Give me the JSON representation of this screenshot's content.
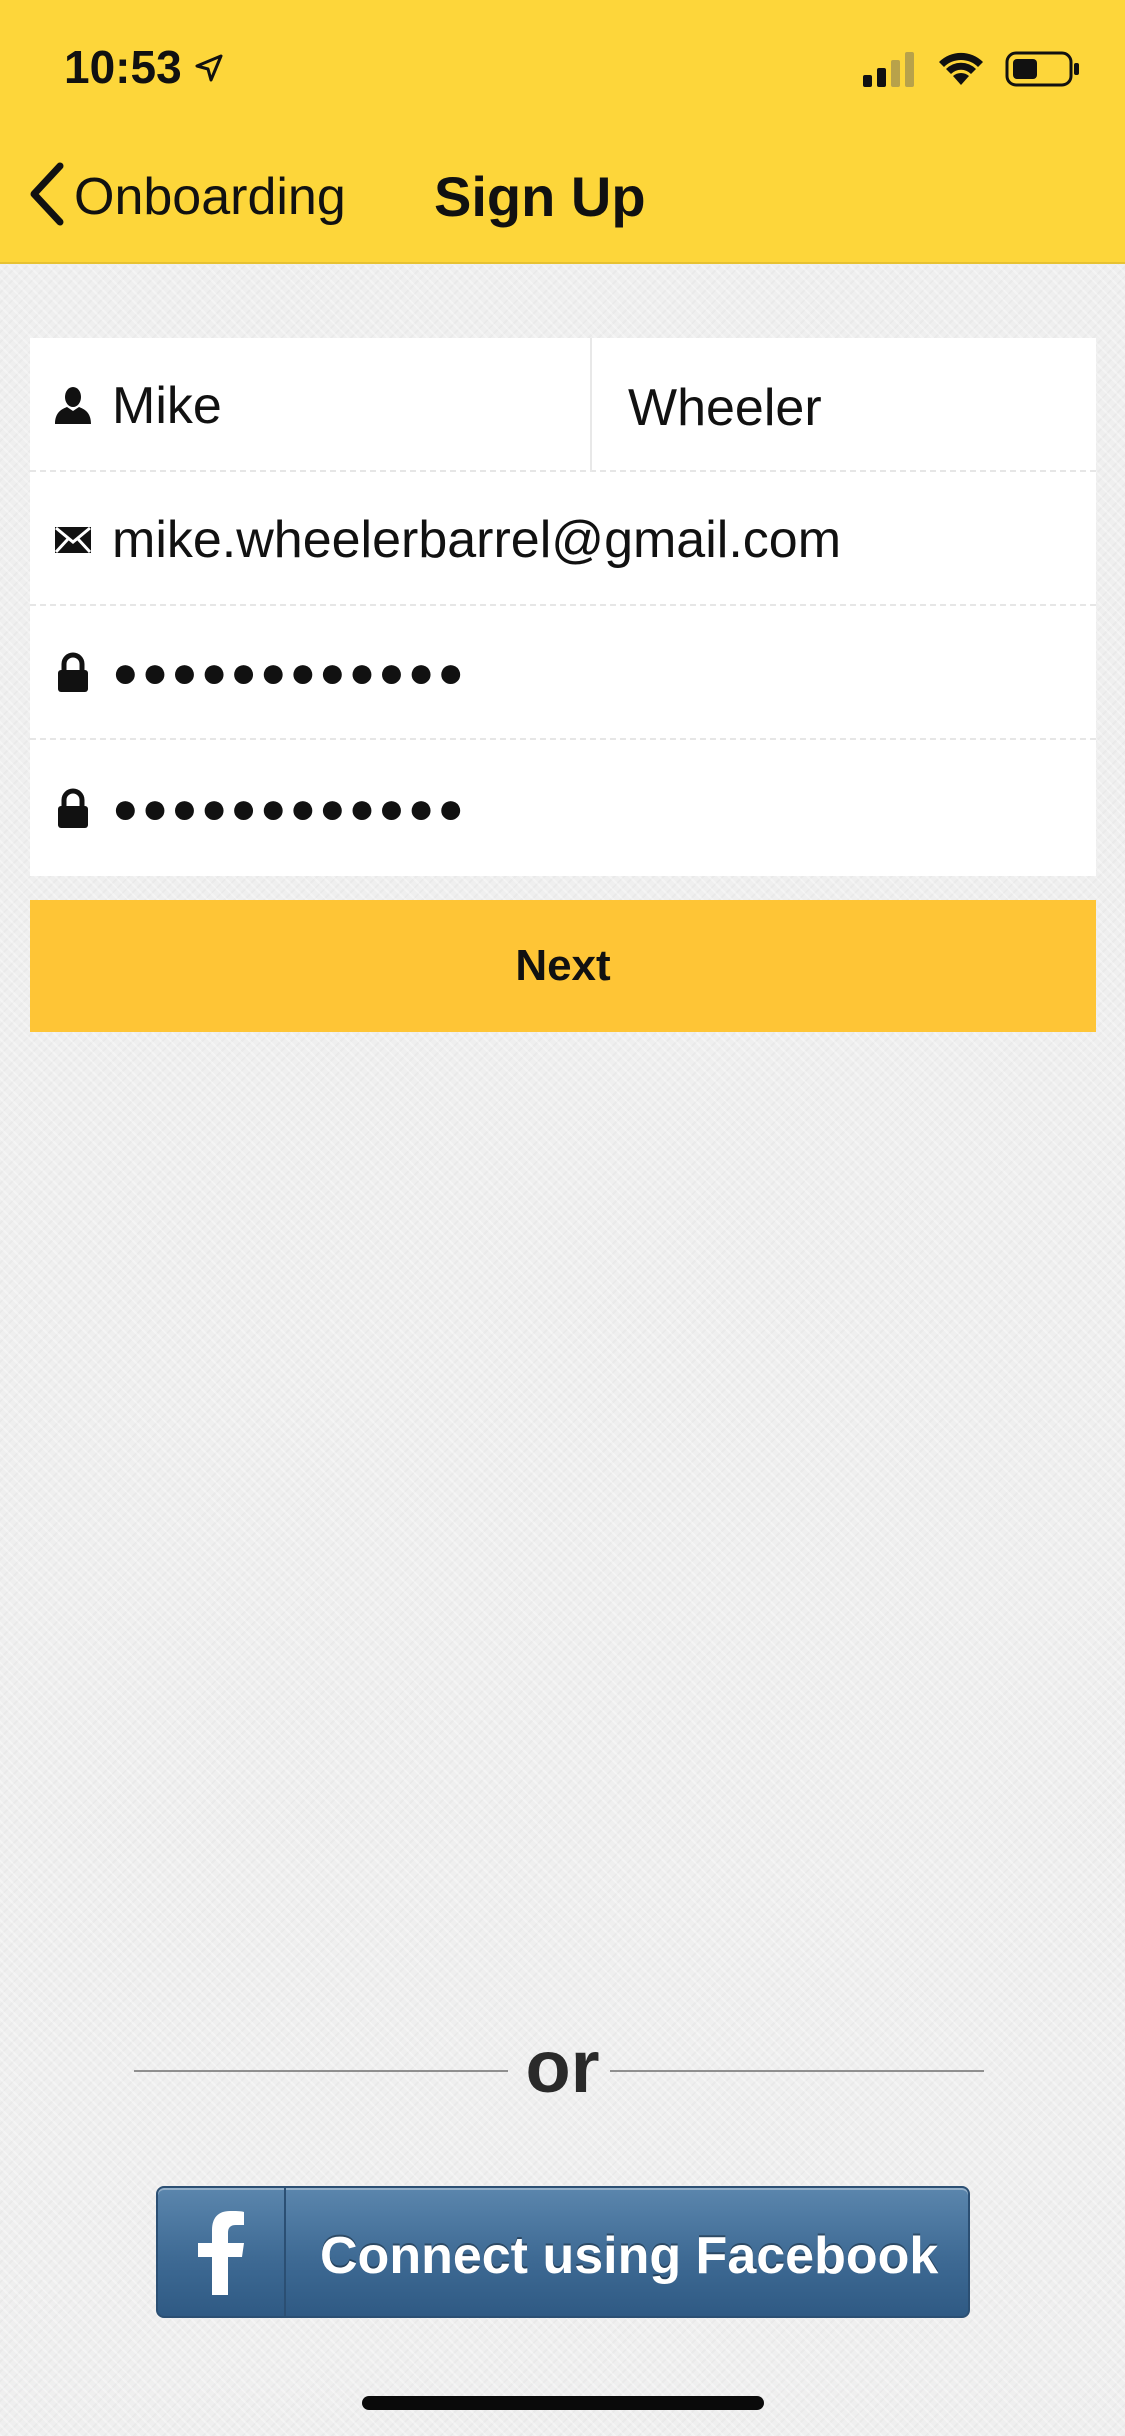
{
  "status_bar": {
    "time": "10:53",
    "icons": [
      "location-arrow-icon",
      "cellular-signal-icon",
      "wifi-icon",
      "battery-icon"
    ]
  },
  "nav": {
    "back_label": "Onboarding",
    "title": "Sign Up"
  },
  "form": {
    "first_name": "Mike",
    "last_name": "Wheeler",
    "email": "mike.wheelerbarrel@gmail.com",
    "password_masked": "●●●●●●●●●●●●",
    "confirm_password_masked": "●●●●●●●●●●●●"
  },
  "next_button": {
    "label": "Next"
  },
  "divider": {
    "label": "or"
  },
  "facebook_button": {
    "label": "Connect using Facebook"
  },
  "colors": {
    "header": "#fdd63a",
    "next_button": "#fec536",
    "facebook": "#3e6a94",
    "background": "#efefef"
  }
}
